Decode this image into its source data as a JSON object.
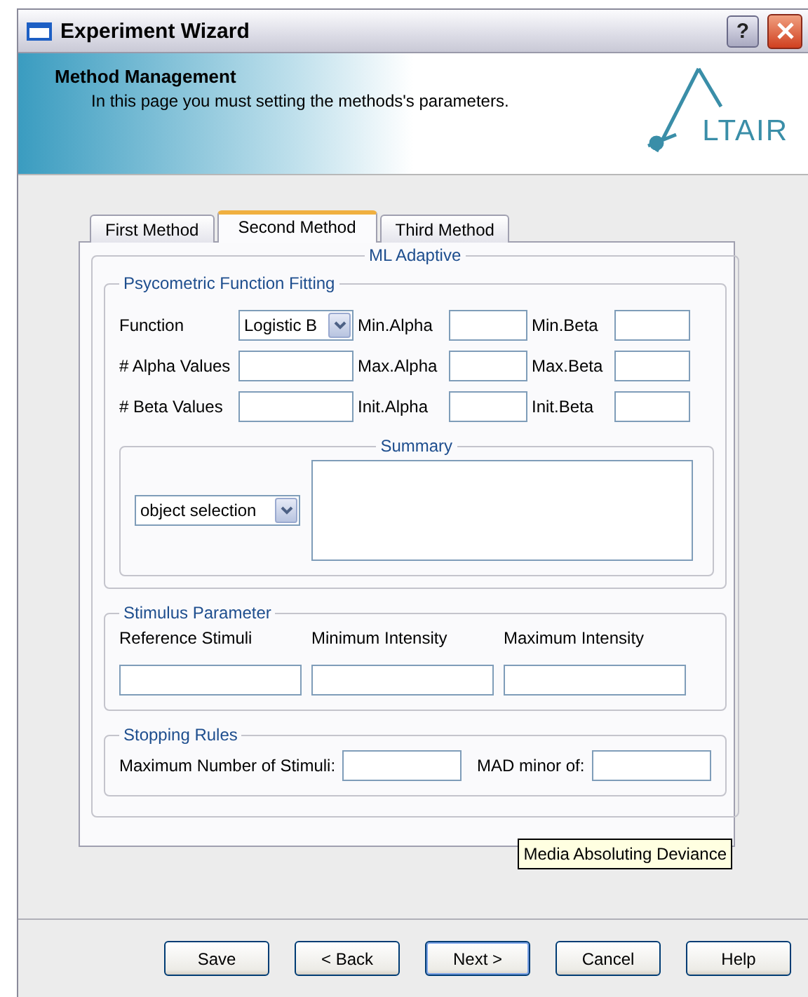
{
  "window": {
    "title": "Experiment Wizard",
    "help_button": "?"
  },
  "header": {
    "title": "Method Management",
    "subtitle": "In this page you must setting the methods's parameters.",
    "logo": "LTAIR"
  },
  "tabs": [
    {
      "label": "First Method",
      "selected": false
    },
    {
      "label": "Second Method",
      "selected": true
    },
    {
      "label": "Third Method",
      "selected": false
    }
  ],
  "group": {
    "title": "ML Adaptive",
    "fitting": {
      "title": "Psycometric Function Fitting",
      "fields": [
        {
          "label": "Function",
          "kind": "dropdown",
          "value": "Logistic B"
        },
        {
          "label": "Min.Alpha",
          "kind": "text"
        },
        {
          "label": "Min.Beta",
          "kind": "text"
        },
        {
          "label": "# Alpha Values",
          "kind": "text"
        },
        {
          "label": "Max.Alpha",
          "kind": "text"
        },
        {
          "label": "Max.Beta",
          "kind": "text"
        },
        {
          "label": "# Beta Values",
          "kind": "text"
        },
        {
          "label": "Init.Alpha",
          "kind": "text"
        },
        {
          "label": "Init.Beta",
          "kind": "text"
        }
      ]
    },
    "summary": {
      "title": "Summary",
      "dropdown": "object selection"
    },
    "stimulus": {
      "title": "Stimulus Parameter",
      "fields": [
        {
          "label": "Reference Stimuli"
        },
        {
          "label": "Minimum Intensity"
        },
        {
          "label": "Maximum Intensity"
        }
      ]
    },
    "stopping": {
      "title": "Stopping Rules",
      "fields": [
        {
          "label": "Maximum Number of Stimuli:"
        },
        {
          "label": "MAD minor of:"
        }
      ]
    }
  },
  "tooltip": "Media Absoluting Deviance",
  "buttons": [
    {
      "label": "Save",
      "default": false
    },
    {
      "label": "< Back",
      "default": false
    },
    {
      "label": "Next >",
      "default": true
    },
    {
      "label": "Cancel",
      "default": false
    },
    {
      "label": "Help",
      "default": false
    }
  ]
}
